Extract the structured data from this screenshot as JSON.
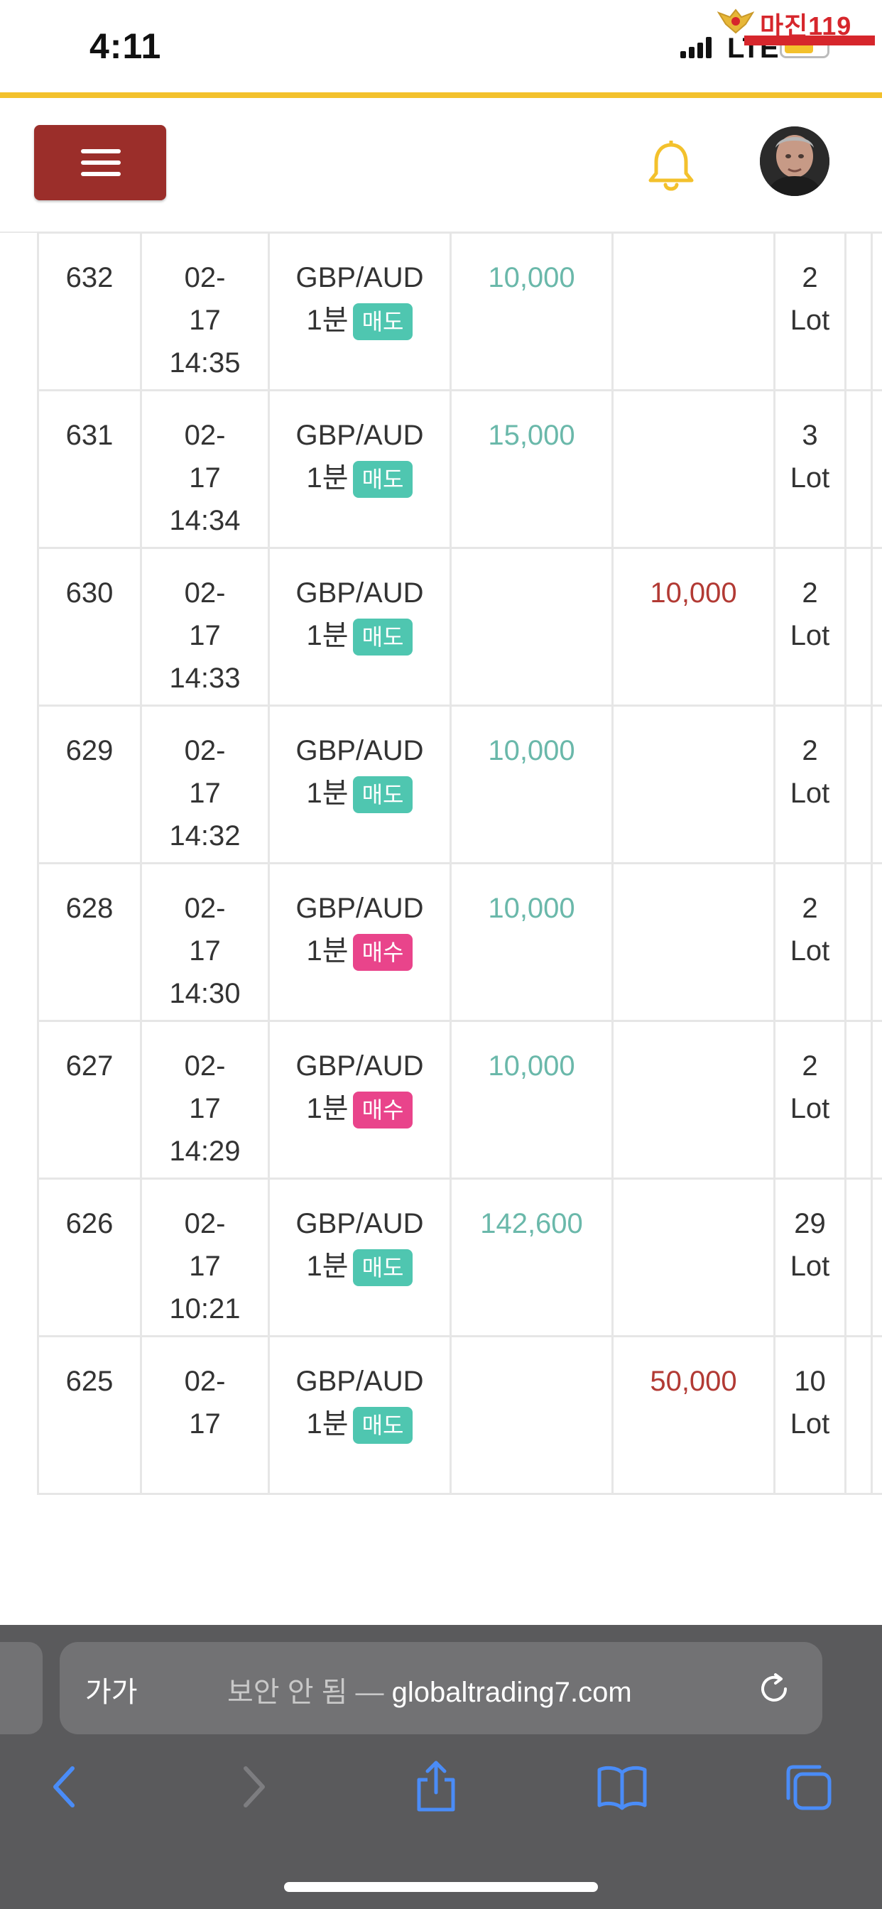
{
  "status_bar": {
    "time": "4:11",
    "network": "LTE",
    "watermark": "마진119"
  },
  "header": {
    "menu_icon": "hamburger-menu-icon",
    "bell_icon": "bell-icon",
    "avatar_icon": "user-avatar",
    "accent_color": "#f3c12c",
    "menu_color": "#9b2e2a"
  },
  "table": {
    "rows": [
      {
        "id": "632",
        "date": "02-",
        "day": "17",
        "time": "14:35",
        "symbol": "GBP/AUD",
        "period": "1분",
        "side": "매도",
        "side_type": "sell",
        "profit": "10,000",
        "loss": "",
        "qty": "2",
        "unit": "Lot"
      },
      {
        "id": "631",
        "date": "02-",
        "day": "17",
        "time": "14:34",
        "symbol": "GBP/AUD",
        "period": "1분",
        "side": "매도",
        "side_type": "sell",
        "profit": "15,000",
        "loss": "",
        "qty": "3",
        "unit": "Lot"
      },
      {
        "id": "630",
        "date": "02-",
        "day": "17",
        "time": "14:33",
        "symbol": "GBP/AUD",
        "period": "1분",
        "side": "매도",
        "side_type": "sell",
        "profit": "",
        "loss": "10,000",
        "qty": "2",
        "unit": "Lot"
      },
      {
        "id": "629",
        "date": "02-",
        "day": "17",
        "time": "14:32",
        "symbol": "GBP/AUD",
        "period": "1분",
        "side": "매도",
        "side_type": "sell",
        "profit": "10,000",
        "loss": "",
        "qty": "2",
        "unit": "Lot"
      },
      {
        "id": "628",
        "date": "02-",
        "day": "17",
        "time": "14:30",
        "symbol": "GBP/AUD",
        "period": "1분",
        "side": "매수",
        "side_type": "buy",
        "profit": "10,000",
        "loss": "",
        "qty": "2",
        "unit": "Lot"
      },
      {
        "id": "627",
        "date": "02-",
        "day": "17",
        "time": "14:29",
        "symbol": "GBP/AUD",
        "period": "1분",
        "side": "매수",
        "side_type": "buy",
        "profit": "10,000",
        "loss": "",
        "qty": "2",
        "unit": "Lot"
      },
      {
        "id": "626",
        "date": "02-",
        "day": "17",
        "time": "10:21",
        "symbol": "GBP/AUD",
        "period": "1분",
        "side": "매도",
        "side_type": "sell",
        "profit": "142,600",
        "loss": "",
        "qty": "29",
        "unit": "Lot"
      },
      {
        "id": "625",
        "date": "02-",
        "day": "17",
        "time": "",
        "symbol": "GBP/AUD",
        "period": "1분",
        "side": "매도",
        "side_type": "sell",
        "profit": "",
        "loss": "50,000",
        "qty": "10",
        "unit": "Lot"
      }
    ],
    "colors": {
      "profit": "#6ab8aa",
      "loss": "#b23a34",
      "sell_badge": "#4fc6b0",
      "buy_badge": "#e9448b"
    }
  },
  "browser": {
    "aa_label": "가가",
    "security_label": "보안 안 됨",
    "separator": " — ",
    "domain": "globaltrading7.com",
    "icons": [
      "back-icon",
      "forward-icon",
      "share-icon",
      "bookmarks-icon",
      "tabs-icon",
      "reload-icon"
    ]
  }
}
